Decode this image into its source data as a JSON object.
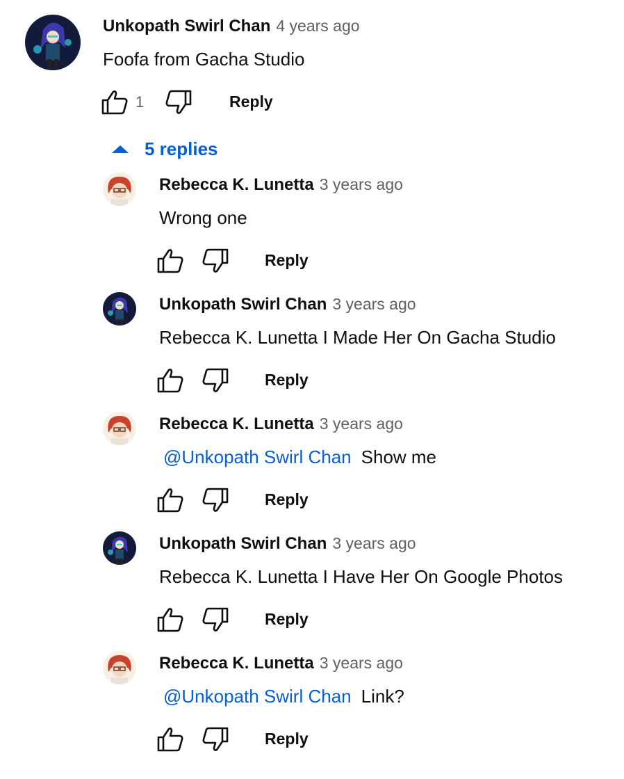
{
  "comment": {
    "author": "Unkopath Swirl Chan",
    "time": "4 years ago",
    "text": "Foofa from Gacha Studio",
    "likes": "1",
    "reply_label": "Reply",
    "avatar": "gacha-character-avatar"
  },
  "replies_toggle": {
    "label": "5 replies"
  },
  "replies": [
    {
      "author": "Rebecca K. Lunetta",
      "time": "3 years ago",
      "mention": "",
      "text": "Wrong one",
      "reply_label": "Reply",
      "avatar": "red-hair-avatar"
    },
    {
      "author": "Unkopath Swirl Chan",
      "time": "3 years ago",
      "mention": "",
      "text": "Rebecca K. Lunetta I Made Her On Gacha Studio",
      "reply_label": "Reply",
      "avatar": "gacha-character-avatar"
    },
    {
      "author": "Rebecca K. Lunetta",
      "time": "3 years ago",
      "mention": "@Unkopath Swirl Chan",
      "text": "Show me",
      "reply_label": "Reply",
      "avatar": "red-hair-avatar"
    },
    {
      "author": "Unkopath Swirl Chan",
      "time": "3 years ago",
      "mention": "",
      "text": "Rebecca K. Lunetta I Have Her On Google Photos",
      "reply_label": "Reply",
      "avatar": "gacha-character-avatar"
    },
    {
      "author": "Rebecca K. Lunetta",
      "time": "3 years ago",
      "mention": "@Unkopath Swirl Chan",
      "text": "Link?",
      "reply_label": "Reply",
      "avatar": "red-hair-avatar"
    }
  ],
  "colors": {
    "link": "#065fd4",
    "text": "#0f0f0f",
    "meta": "#606060"
  }
}
